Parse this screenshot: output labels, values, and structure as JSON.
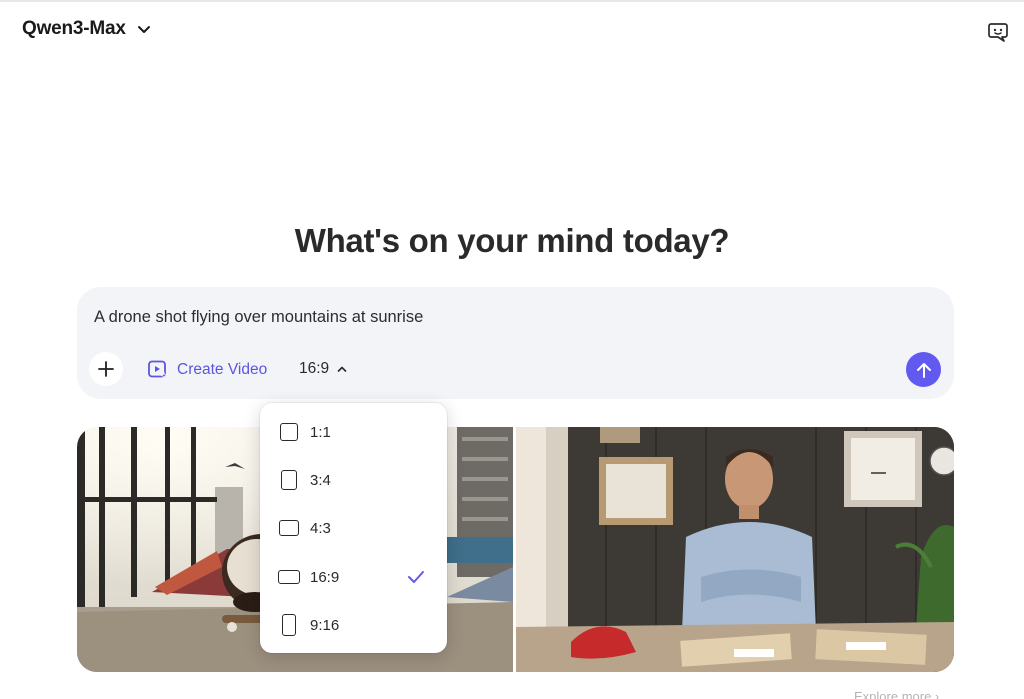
{
  "header": {
    "model_name": "Qwen3-Max",
    "model_dropdown_icon": "chevron-down-icon",
    "new_chat_icon": "chat-bubble-icon"
  },
  "main": {
    "headline": "What's on your mind today?"
  },
  "composer": {
    "input_value": "A drone shot flying over mountains at sunrise",
    "attach_icon": "plus-icon",
    "mode_icon": "video-sparkle-icon",
    "mode_label": "Create Video",
    "aspect_ratio": "16:9",
    "aspect_ratio_icon": "chevron-up-icon",
    "send_icon": "arrow-up-icon"
  },
  "ratio_menu": {
    "options": [
      {
        "label": "1:1",
        "selected": false
      },
      {
        "label": "3:4",
        "selected": false
      },
      {
        "label": "4:3",
        "selected": false
      },
      {
        "label": "16:9",
        "selected": true
      },
      {
        "label": "9:16",
        "selected": false
      }
    ],
    "check_icon": "checkmark-icon"
  },
  "gallery": {
    "images": [
      "skatepark-scene-image",
      "office-man-relaxing-image"
    ]
  },
  "footer": {
    "explore_label": "Explore more"
  },
  "colors": {
    "accent": "#6259f0",
    "accent_text": "#5b55e0",
    "composer_bg": "#f3f4f8"
  }
}
